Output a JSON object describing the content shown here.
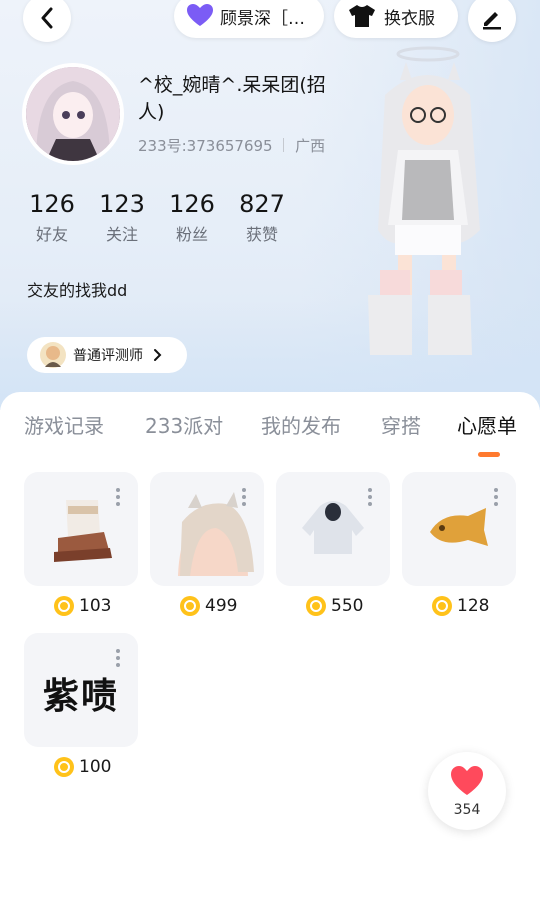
{
  "header": {
    "partner_label": "顾景深［…",
    "outfit_label": "换衣服"
  },
  "profile": {
    "username": "^校_婉晴^.呆呆团(招人)",
    "id_text": "233号:373657695",
    "region": "广西",
    "bio": "交友的找我dd",
    "badge_label": "普通评测师"
  },
  "stats": [
    {
      "value": "126",
      "label": "好友"
    },
    {
      "value": "123",
      "label": "关注"
    },
    {
      "value": "126",
      "label": "粉丝"
    },
    {
      "value": "827",
      "label": "获赞"
    }
  ],
  "tabs": [
    {
      "label": "游戏记录",
      "active": false
    },
    {
      "label": "233派对",
      "active": false
    },
    {
      "label": "我的发布",
      "active": false
    },
    {
      "label": "穿搭",
      "active": false
    },
    {
      "label": "心愿单",
      "active": true
    }
  ],
  "wishlist": [
    {
      "item": "boots",
      "price": "103"
    },
    {
      "item": "ponytail-hair",
      "price": "499"
    },
    {
      "item": "hoodie",
      "price": "550"
    },
    {
      "item": "taiyaki",
      "price": "128"
    },
    {
      "item": "text-sticker",
      "price": "100",
      "sticker_text": "紫啧"
    }
  ],
  "like_fab": {
    "count": "354"
  },
  "colors": {
    "accent": "#ff7a2f",
    "heart": "#ff4a5c",
    "coin": "#ffc21a",
    "partner_heart": "#7b5cf5"
  }
}
